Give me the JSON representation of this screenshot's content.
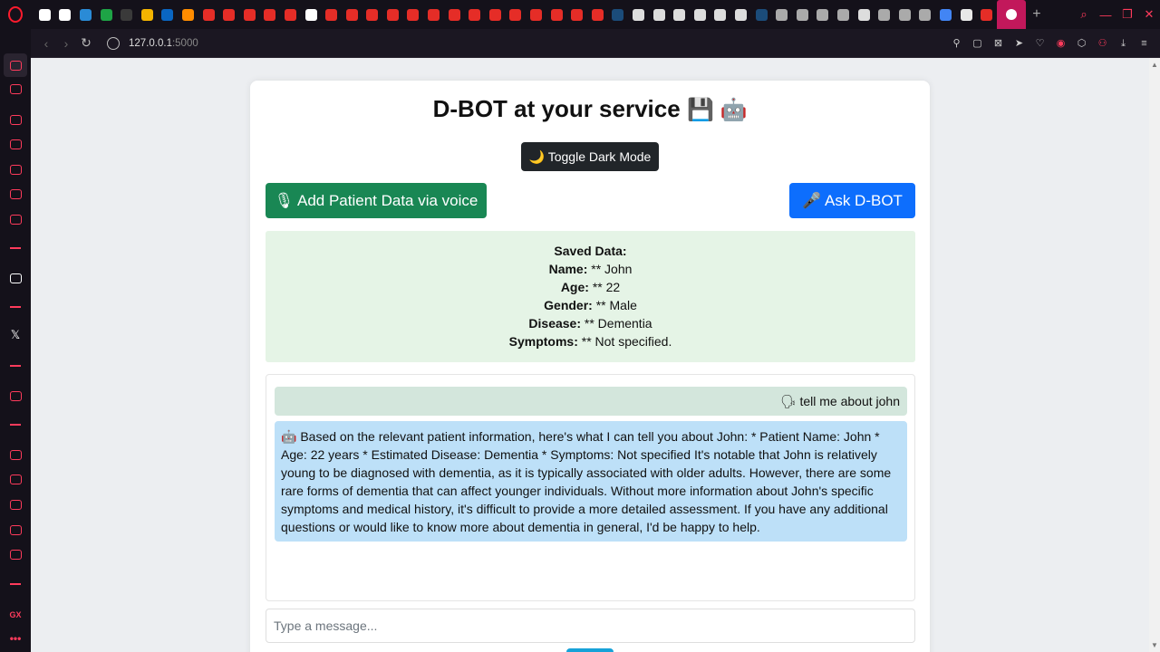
{
  "browser": {
    "url_host": "127.0.0.1",
    "url_port": ":5000",
    "tab_favicon_colors": [
      "#ffffff",
      "#ffffff",
      "#2a8bd6",
      "#1ea446",
      "#3a3a3a",
      "#f4b400",
      "#0a66c2",
      "#ff8c00",
      "#e52d27",
      "#e52d27",
      "#e52d27",
      "#e52d27",
      "#e52d27",
      "#ffffff",
      "#e52d27",
      "#e52d27",
      "#e52d27",
      "#e52d27",
      "#e52d27",
      "#e52d27",
      "#e52d27",
      "#e52d27",
      "#e52d27",
      "#e52d27",
      "#e52d27",
      "#e52d27",
      "#e52d27",
      "#e52d27",
      "#1b4c7a",
      "#dddddd",
      "#dddddd",
      "#dddddd",
      "#dddddd",
      "#dddddd",
      "#dddddd",
      "#1b4c7a",
      "#aaaaaa",
      "#aaaaaa",
      "#aaaaaa",
      "#aaaaaa",
      "#dddddd",
      "#aaaaaa",
      "#aaaaaa",
      "#aaaaaa",
      "#4285f4",
      "#e8e8e8",
      "#e52d27"
    ],
    "new_tab_label": "+"
  },
  "page": {
    "title": "D-BOT at your service",
    "title_emojis": "💾 🤖",
    "toggle_dark_label": "🌙 Toggle Dark Mode",
    "add_voice_label": "🎙 Add Patient Data via voice",
    "ask_label": "🎤 Ask D-BOT",
    "saved": {
      "heading": "Saved Data:",
      "fields": [
        {
          "label": "Name:",
          "value": " ** John"
        },
        {
          "label": "Age:",
          "value": " ** 22"
        },
        {
          "label": "Gender:",
          "value": " ** Male"
        },
        {
          "label": "Disease:",
          "value": " ** Dementia"
        },
        {
          "label": "Symptoms:",
          "value": " ** Not specified."
        }
      ]
    },
    "chat": {
      "user_message": "🗣 tell me about john",
      "bot_message": "🤖 Based on the relevant patient information, here's what I can tell you about John: * Patient Name: John * Age: 22 years * Estimated Disease: Dementia * Symptoms: Not specified It's notable that John is relatively young to be diagnosed with dementia, as it is typically associated with older adults. However, there are some rare forms of dementia that can affect younger individuals. Without more information about John's specific symptoms and medical history, it's difficult to provide a more detailed assessment. If you have any additional questions or would like to know more about dementia in general, I'd be happy to help."
    },
    "input_placeholder": "Type a message..."
  },
  "colors": {
    "green_button": "#198754",
    "blue_button": "#0d6efd",
    "dark_button": "#212529",
    "saved_bg": "#e5f4e6",
    "user_bubble": "#d3e6dc",
    "bot_bubble": "#bde0f8",
    "opera_red": "#ff3b5c"
  }
}
